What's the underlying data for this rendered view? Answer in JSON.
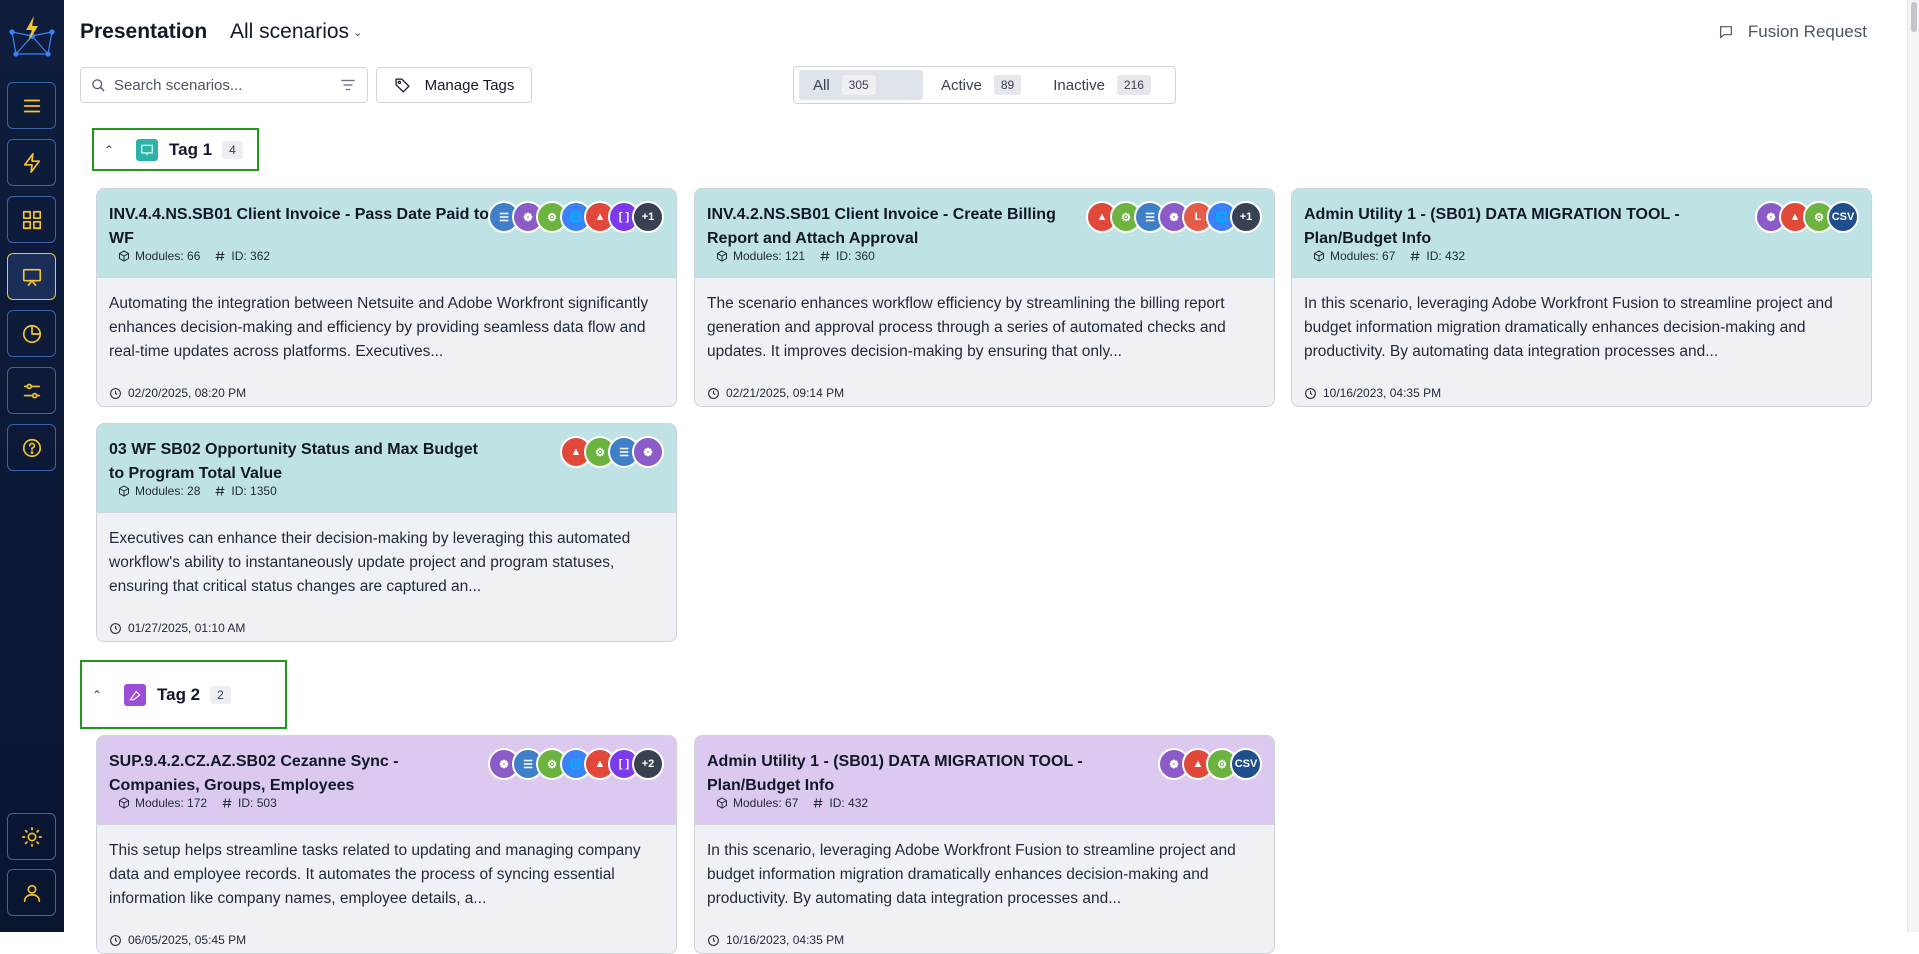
{
  "header": {
    "title": "Presentation",
    "scenario_filter": "All scenarios",
    "fusion_request": "Fusion Request"
  },
  "toolbar": {
    "search_placeholder": "Search scenarios...",
    "manage_tags": "Manage Tags",
    "filters": [
      {
        "label": "All",
        "count": "305",
        "active": true
      },
      {
        "label": "Active",
        "count": "89",
        "active": false
      },
      {
        "label": "Inactive",
        "count": "216",
        "active": false
      }
    ]
  },
  "sidebar": {
    "icons": [
      "logo-icon",
      "menu-icon",
      "lightning-icon",
      "dashboard-icon",
      "presentation-icon",
      "chart-pie-icon",
      "sliders-icon",
      "help-icon",
      "sun-icon",
      "user-icon"
    ]
  },
  "tags": [
    {
      "name": "Tag 1",
      "count": "4",
      "color": "#2ab3a6",
      "cards": [
        {
          "title": "INV.4.4.NS.SB01 Client Invoice - Pass Date Paid to WF",
          "modules": "Modules: 66",
          "id": "ID: 362",
          "description": "Automating the integration between Netsuite and Adobe Workfront significantly enhances decision-making and efficiency by providing seamless data flow and real-time updates across platforms. Executives...",
          "date": "02/20/2025, 08:20 PM",
          "apps": [
            "database",
            "workfront",
            "gear",
            "globe",
            "brave",
            "bracket"
          ],
          "more": "+1"
        },
        {
          "title": "INV.4.2.NS.SB01 Client Invoice - Create Billing Report and Attach Approval",
          "modules": "Modules: 121",
          "id": "ID: 360",
          "description": "The scenario enhances workflow efficiency by streamlining the billing report generation and approval process through a series of automated checks and updates. It improves decision-making by ensuring that only...",
          "date": "02/21/2025, 09:14 PM",
          "apps": [
            "brave",
            "gear",
            "database",
            "workfront",
            "letter-l",
            "globe"
          ],
          "more": "+1"
        },
        {
          "title": "Admin Utility 1 - (SB01) DATA MIGRATION TOOL - Plan/Budget Info",
          "modules": "Modules: 67",
          "id": "ID: 432",
          "description": "In this scenario, leveraging Adobe Workfront Fusion to streamline project and budget information migration dramatically enhances decision-making and productivity. By automating data integration processes and...",
          "date": "10/16/2023, 04:35 PM",
          "apps": [
            "workfront",
            "brave",
            "gear",
            "csv"
          ],
          "more": ""
        },
        {
          "title": "03 WF SB02 Opportunity Status and Max Budget to Program Total Value",
          "modules": "Modules: 28",
          "id": "ID: 1350",
          "description": "Executives can enhance their decision-making by leveraging this automated workflow's ability to instantaneously update project and program statuses, ensuring that critical status changes are captured an...",
          "date": "01/27/2025, 01:10 AM",
          "apps": [
            "brave",
            "gear",
            "database",
            "workfront"
          ],
          "more": ""
        }
      ]
    },
    {
      "name": "Tag 2",
      "count": "2",
      "color": "#9b4fd6",
      "cards": [
        {
          "title": "SUP.9.4.2.CZ.AZ.SB02 Cezanne Sync - Companies, Groups, Employees",
          "modules": "Modules: 172",
          "id": "ID: 503",
          "description": "This setup helps streamline tasks related to updating and managing company data and employee records. It automates the process of syncing essential information like company names, employee details, a...",
          "date": "06/05/2025, 05:45 PM",
          "apps": [
            "workfront",
            "database",
            "gear",
            "globe",
            "brave",
            "bracket"
          ],
          "more": "+2"
        },
        {
          "title": "Admin Utility 1 - (SB01) DATA MIGRATION TOOL - Plan/Budget Info",
          "modules": "Modules: 67",
          "id": "ID: 432",
          "description": "In this scenario, leveraging Adobe Workfront Fusion to streamline project and budget information migration dramatically enhances decision-making and productivity. By automating data integration processes and...",
          "date": "10/16/2023, 04:35 PM",
          "apps": [
            "workfront",
            "brave",
            "gear",
            "csv"
          ],
          "more": ""
        }
      ]
    }
  ],
  "app_colors": {
    "database": "#3f7fc8",
    "workfront": "#8b5cc8",
    "gear": "#6db33f",
    "globe": "#3b82f6",
    "brave": "#e0483a",
    "bracket": "#7c3aed",
    "letter-l": "#e25c4a",
    "csv": "#1e4e8c",
    "more": "#374151"
  },
  "colors": {
    "sidebar_accent": "#f6c52c",
    "tag_outline": "#22961f",
    "teal_header": "#bfe3e4",
    "violet_header": "#dbc9ef"
  }
}
